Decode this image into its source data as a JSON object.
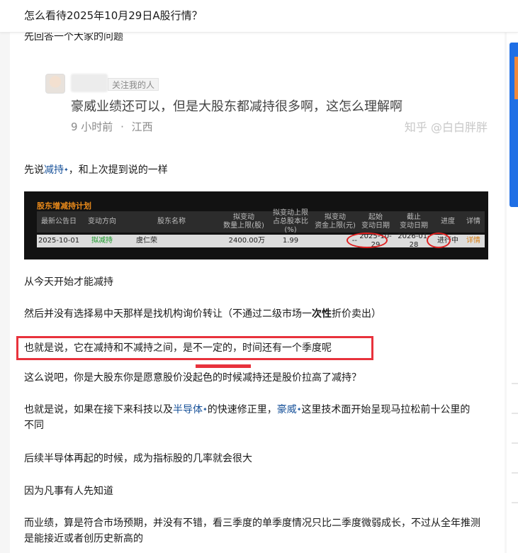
{
  "question_title": "怎么看待2025年10月29日A股行情？",
  "clipped_top_text": "先回答一个大家的问题",
  "embed": {
    "follow_tag": "关注我的人",
    "comment": "豪威业绩还可以，但是大股东都减持很多啊，这怎么理解啊",
    "time": "9 小时前",
    "sep": "·",
    "location": "江西",
    "watermark": "知乎 @白白胖胖"
  },
  "para1": {
    "pre": "先说",
    "link": "减持",
    "post": "，和上次提到说的一样"
  },
  "table": {
    "title": "股东增减持计划",
    "headers": [
      "最新公告日",
      "变动方向",
      "股东名称",
      "拟变动\n数量上限(股)",
      "拟变动上限\n占总股本比(%)",
      "拟变动\n资金上限(元)",
      "起始\n变动日期",
      "截止\n变动日期",
      "进度",
      "详情"
    ],
    "row": [
      "2025-10-01",
      "拟减持",
      "虞仁荣",
      "2400.00万",
      "1.99",
      "--",
      "2025-10-29",
      "2026-01-28",
      "进行中",
      "详情"
    ]
  },
  "para2": "从今天开始才能减持",
  "para3": {
    "pre": "然后并没有选择易中天那样是找机构询价转让（不通过二级市场一",
    "bold": "次性",
    "post": "折价卖出）"
  },
  "para4": "也就是说，它在减持和不减持之间，是不一定的，时间还有一个季度呢",
  "para5": "这么说吧，你是大股东你是愿意股价没起色的时候减持还是股价拉高了减持？",
  "para6": {
    "pre": "也就是说，如果在接下来科技以及",
    "link1": "半导体",
    "mid": "的快速修正里，",
    "link2": "豪威",
    "post": "这里技术面开始呈现马拉松前十公里的不同"
  },
  "para7": "后续半导体再起的时候，成为指标股的几率就会很大",
  "para8": "因为凡事有人先知道",
  "para9": "而业绩，算是符合市场预期，并没有不错，看三季度的单季度情况只比二季度微弱成长，不过从全年推测是能接近或者创历史新高的",
  "colors": {
    "link": "#175199",
    "highlight": "#e8323c",
    "table_orange": "#d87e12",
    "table_green": "#1a9b2a"
  },
  "icons": {
    "link_spark": "spark-icon"
  }
}
